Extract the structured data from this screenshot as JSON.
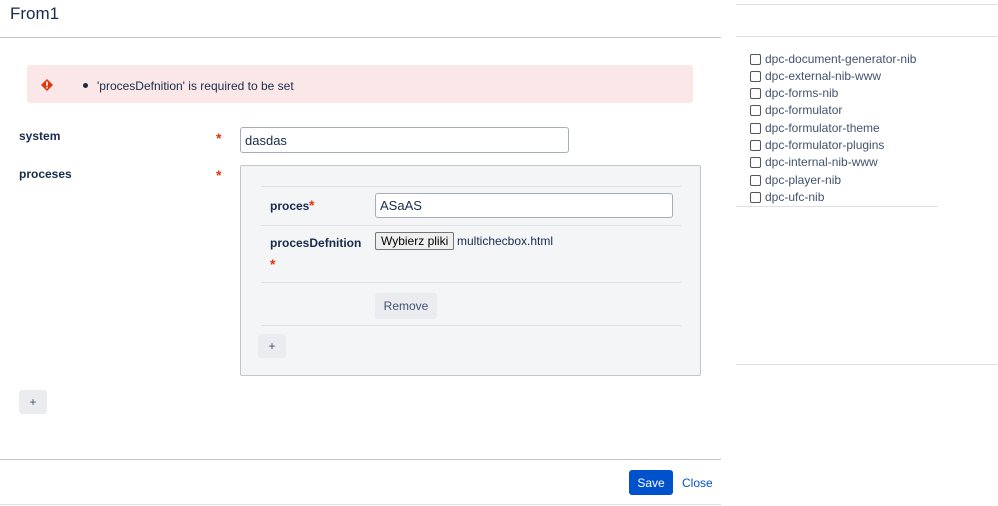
{
  "modal": {
    "title": "From1",
    "error": {
      "message": "'procesDefnition' is required to be set"
    },
    "fields": {
      "system_label": "system",
      "system_required": "*",
      "system_value": "dasdas",
      "proceses_label": "proceses",
      "proceses_required": "*"
    },
    "proceses_panel": {
      "proces_label": "proces",
      "proces_required": "*",
      "proces_value": "ASaAS",
      "procesdefnition_label": "procesDefnition",
      "procesdefnition_required": "*",
      "file_button_label": "Wybierz pliki",
      "file_name": "multichecbox.html",
      "remove_label": "Remove",
      "add_inner_label": "+"
    },
    "add_outer_label": "+",
    "footer": {
      "save_label": "Save",
      "close_label": "Close"
    }
  },
  "sidebar": {
    "checkboxes": [
      {
        "label": "dpc-document-generator-nib",
        "checked": false
      },
      {
        "label": "dpc-external-nib-www",
        "checked": false
      },
      {
        "label": "dpc-forms-nib",
        "checked": false
      },
      {
        "label": "dpc-formulator",
        "checked": false
      },
      {
        "label": "dpc-formulator-theme",
        "checked": false
      },
      {
        "label": "dpc-formulator-plugins",
        "checked": false
      },
      {
        "label": "dpc-internal-nib-www",
        "checked": false
      },
      {
        "label": "dpc-player-nib",
        "checked": false
      },
      {
        "label": "dpc-ufc-nib",
        "checked": false
      }
    ]
  },
  "colors": {
    "primary": "#0052cc",
    "error_bg": "#fbe7e7",
    "error_icon": "#de350b",
    "required": "#de350b"
  },
  "icons": {
    "error": "error-diamond-icon"
  }
}
